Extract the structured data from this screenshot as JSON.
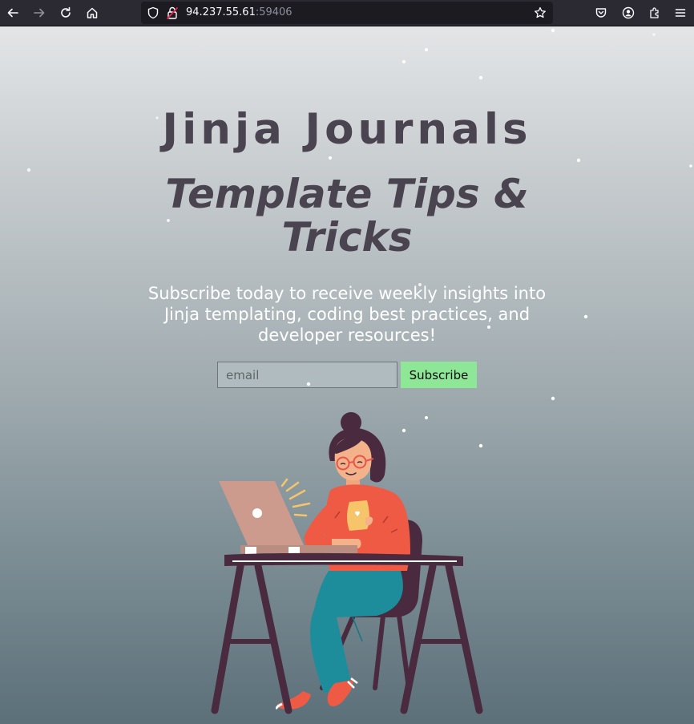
{
  "browser": {
    "url_host": "94.237.55.61",
    "url_port": ":59406",
    "icons": [
      "back-arrow-icon",
      "forward-arrow-icon",
      "reload-icon",
      "home-icon",
      "shield-icon",
      "insecure-lock-icon",
      "bookmark-star-icon",
      "pocket-icon",
      "account-icon",
      "extensions-icon",
      "menu-icon"
    ]
  },
  "hero": {
    "brand": "Jinja Journals",
    "headline": "Template Tips & Tricks",
    "tagline": "Subscribe today to receive weekly insights into Jinja templating, coding best practices, and developer resources!"
  },
  "form": {
    "email_placeholder": "email",
    "email_value": "",
    "subscribe_label": "Subscribe"
  },
  "colors": {
    "heading": "#4a4450",
    "button": "#8ee697",
    "sweater": "#ef5a45",
    "jeans": "#1d8d9c",
    "desk": "#4a2a3e"
  }
}
